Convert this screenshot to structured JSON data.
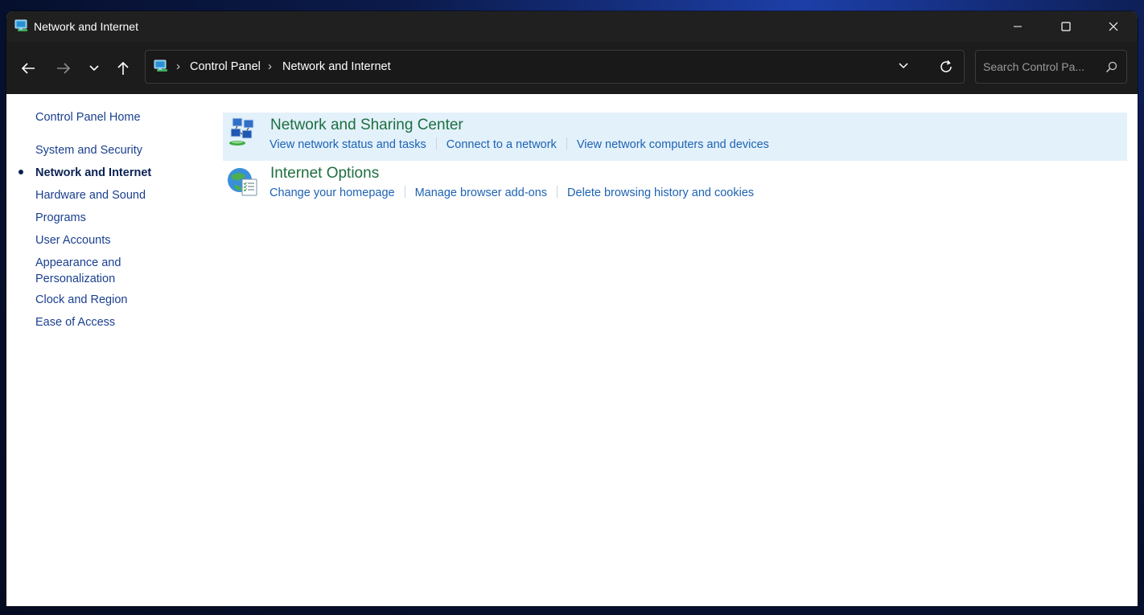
{
  "window": {
    "title": "Network and Internet"
  },
  "address_bar": {
    "breadcrumbs": [
      "Control Panel",
      "Network and Internet"
    ]
  },
  "search": {
    "placeholder": "Search Control Pa..."
  },
  "sidebar": {
    "home": "Control Panel Home",
    "items": [
      {
        "label": "System and Security",
        "active": false
      },
      {
        "label": "Network and Internet",
        "active": true
      },
      {
        "label": "Hardware and Sound",
        "active": false
      },
      {
        "label": "Programs",
        "active": false
      },
      {
        "label": "User Accounts",
        "active": false
      },
      {
        "label": "Appearance and Personalization",
        "active": false
      },
      {
        "label": "Clock and Region",
        "active": false
      },
      {
        "label": "Ease of Access",
        "active": false
      }
    ]
  },
  "categories": [
    {
      "title": "Network and Sharing Center",
      "icon": "network-sharing-icon",
      "links": [
        "View network status and tasks",
        "Connect to a network",
        "View network computers and devices"
      ]
    },
    {
      "title": "Internet Options",
      "icon": "globe-icon",
      "links": [
        "Change your homepage",
        "Manage browser add-ons",
        "Delete browsing history and cookies"
      ]
    }
  ],
  "colors": {
    "title_link": "#1e6f3f",
    "task_link": "#1d62b3",
    "sidebar_link": "#1a3f8f",
    "hover_row": "#e3f1fb",
    "toolbar_bg": "#1c1c1c"
  }
}
